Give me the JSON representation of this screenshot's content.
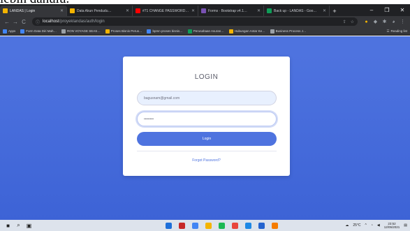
{
  "caption_fragment": "lebih dahulu.",
  "browser": {
    "tabs": [
      {
        "label": "LANDAS | Login",
        "color": "#f4b400",
        "active": true
      },
      {
        "label": "Data Akun Pendudu…",
        "color": "#f4b400",
        "active": false
      },
      {
        "label": "#71 CHANGE PASSWORD…",
        "color": "#ff0000",
        "active": false
      },
      {
        "label": "Forms · Bootstrap v4.1…",
        "color": "#7952b3",
        "active": false
      },
      {
        "label": "Back up - LANDAS - Goo…",
        "color": "#0f9d58",
        "active": false
      }
    ],
    "new_tab_label": "+",
    "window_controls": {
      "minimize": "–",
      "maximize": "❐",
      "close": "✕"
    },
    "nav": {
      "back": "←",
      "forward": "→",
      "reload": "C"
    },
    "url_host": "localhost",
    "url_path": "/proyeklandas/auth/login",
    "bookmarks": [
      {
        "label": "Apps",
        "color": "#4285f4"
      },
      {
        "label": "Form Data Diri Mah…",
        "color": "#4285f4"
      },
      {
        "label": "RON VOYAGE SEAS…",
        "color": "#9aa0a6"
      },
      {
        "label": "Proses Bisnis Perus…",
        "color": "#f4b400"
      },
      {
        "label": "bpmn proses bisnis…",
        "color": "#4285f4"
      },
      {
        "label": "Perusahaan Asuran…",
        "color": "#0f9d58"
      },
      {
        "label": "Hubungan Antar Ke…",
        "color": "#f4b400"
      },
      {
        "label": "Business Process J…",
        "color": "#9aa0a6"
      }
    ],
    "reading_list": "Reading list"
  },
  "login": {
    "title": "LOGIN",
    "email_value": "bagusnam@gmail.com",
    "password_mask": "••••••••",
    "button_label": "Login",
    "forgot_label": "Forgot Password?"
  },
  "taskbar": {
    "temperature": "25°C",
    "time": "23:52",
    "date": "12/05/2021",
    "app_colors": [
      "#1e6fd9",
      "#c62828",
      "#4285f4",
      "#f4b400",
      "#1db954",
      "#e8453c",
      "#1e88e5",
      "#2564cf",
      "#f57c00"
    ]
  },
  "colors": {
    "background": "#4e73df",
    "accent": "#4e73df",
    "card": "#ffffff"
  }
}
